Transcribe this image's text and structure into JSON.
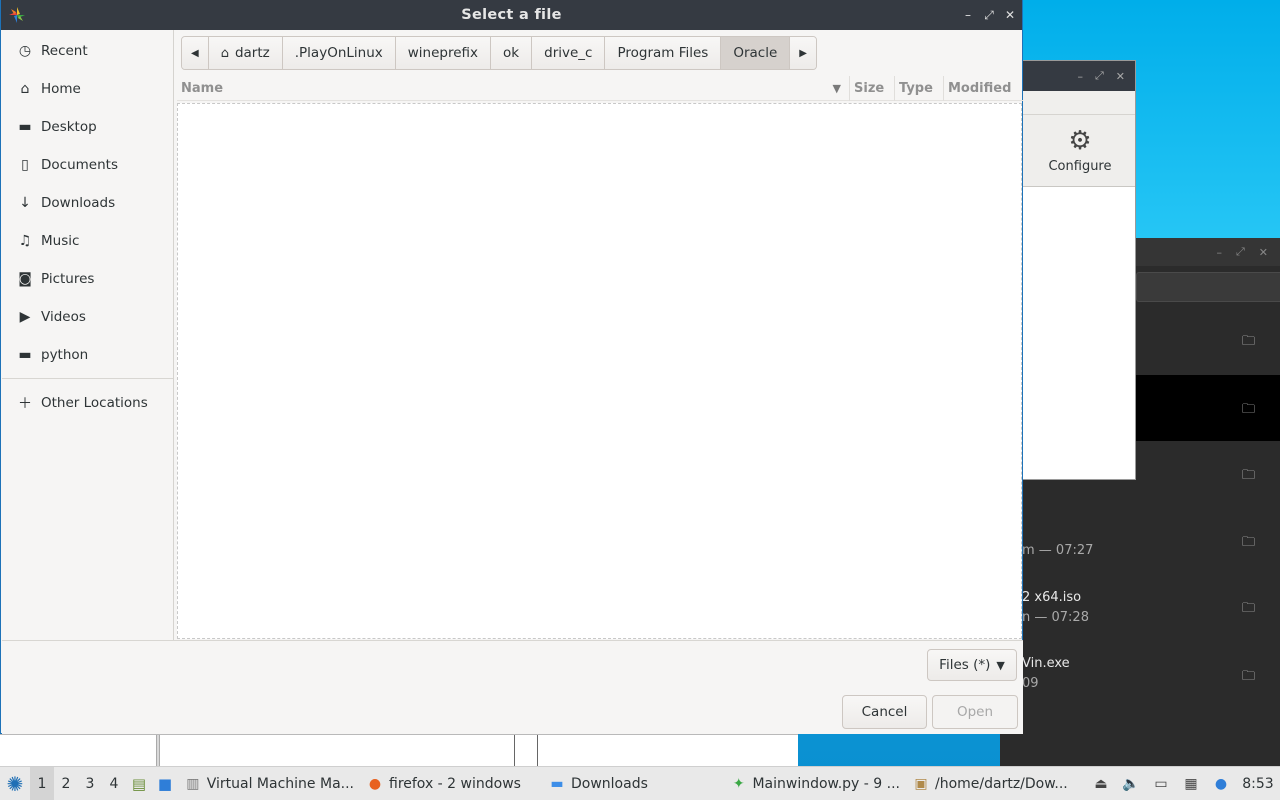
{
  "dialog": {
    "title": "Select a file",
    "controls": {
      "minimize": "–",
      "maximize": "⤢",
      "close": "✕"
    }
  },
  "sidebar": {
    "items": [
      {
        "label": "Recent",
        "icon": "recent-icon"
      },
      {
        "label": "Home",
        "icon": "home-icon"
      },
      {
        "label": "Desktop",
        "icon": "folder-icon"
      },
      {
        "label": "Documents",
        "icon": "documents-icon"
      },
      {
        "label": "Downloads",
        "icon": "download-icon"
      },
      {
        "label": "Music",
        "icon": "music-icon"
      },
      {
        "label": "Pictures",
        "icon": "camera-icon"
      },
      {
        "label": "Videos",
        "icon": "video-icon"
      },
      {
        "label": "python",
        "icon": "folder-icon"
      }
    ],
    "other": {
      "label": "Other Locations",
      "icon": "plus-icon"
    }
  },
  "pathbar": {
    "crumbs": [
      "dartz",
      ".PlayOnLinux",
      "wineprefix",
      "ok",
      "drive_c",
      "Program Files",
      "Oracle"
    ],
    "active": "Oracle"
  },
  "columns": {
    "name": "Name",
    "size": "Size",
    "type": "Type",
    "modified": "Modified"
  },
  "footer": {
    "filter": "Files (*)",
    "cancel": "Cancel",
    "open": "Open"
  },
  "background": {
    "configure_label": "Configure",
    "file_rows": [
      {
        "sub": "m — 07:27"
      },
      {
        "name": "2 x64.iso",
        "sub": "n — 07:28"
      },
      {
        "name": "Vin.exe",
        "sub": "09"
      }
    ]
  },
  "taskbar": {
    "workspaces": [
      "1",
      "2",
      "3",
      "4"
    ],
    "current_workspace": "1",
    "tasks": [
      {
        "label": "Virtual Machine Ma...",
        "icon": "virt-manager-icon"
      },
      {
        "label": "firefox - 2 windows",
        "icon": "firefox-icon"
      },
      {
        "label": "Downloads",
        "icon": "folder-icon"
      },
      {
        "label": "Mainwindow.py - 9 ...",
        "icon": "playonlinux-icon"
      },
      {
        "label": "/home/dartz/Dow...",
        "icon": "archive-icon"
      }
    ],
    "clock": "8:53"
  },
  "colors": {
    "titlebar": "#353a42",
    "dialog_bg": "#f6f5f4",
    "desktop": "#0fa4e2",
    "active_crumb": "#d6d1cd"
  }
}
